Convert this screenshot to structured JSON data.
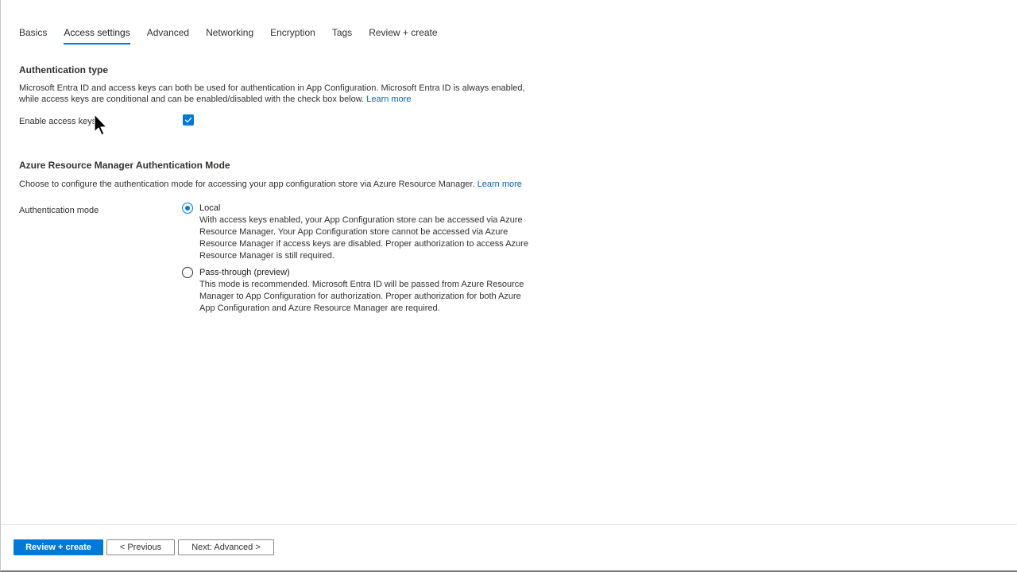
{
  "tabs": [
    {
      "label": "Basics",
      "active": false
    },
    {
      "label": "Access settings",
      "active": true
    },
    {
      "label": "Advanced",
      "active": false
    },
    {
      "label": "Networking",
      "active": false
    },
    {
      "label": "Encryption",
      "active": false
    },
    {
      "label": "Tags",
      "active": false
    },
    {
      "label": "Review + create",
      "active": false
    }
  ],
  "auth_type": {
    "title": "Authentication type",
    "description": "Microsoft Entra ID and access keys can both be used for authentication in App Configuration. Microsoft Entra ID is always enabled, while access keys are conditional and can be enabled/disabled with the check box below.",
    "learn_more": "Learn more",
    "enable_access_keys_label": "Enable access keys",
    "enable_access_keys_checked": true
  },
  "arm_auth": {
    "title": "Azure Resource Manager Authentication Mode",
    "description": "Choose to configure the authentication mode for accessing your app configuration store via Azure Resource Manager.",
    "learn_more": "Learn more",
    "mode_label": "Authentication mode",
    "options": [
      {
        "label": "Local",
        "selected": true,
        "description": "With access keys enabled, your App Configuration store can be accessed via Azure Resource Manager. Your App Configuration store cannot be accessed via Azure Resource Manager if access keys are disabled. Proper authorization to access Azure Resource Manager is still required."
      },
      {
        "label": "Pass-through (preview)",
        "selected": false,
        "description": "This mode is recommended. Microsoft Entra ID will be passed from Azure Resource Manager to App Configuration for authorization. Proper authorization for both Azure App Configuration and Azure Resource Manager are required."
      }
    ]
  },
  "footer": {
    "review_create": "Review + create",
    "previous": "< Previous",
    "next": "Next: Advanced >"
  },
  "colors": {
    "accent": "#0078d4",
    "link": "#0066b8"
  },
  "icons": {
    "checkbox": "checkmark-icon",
    "cursor": "mouse-pointer-icon"
  }
}
